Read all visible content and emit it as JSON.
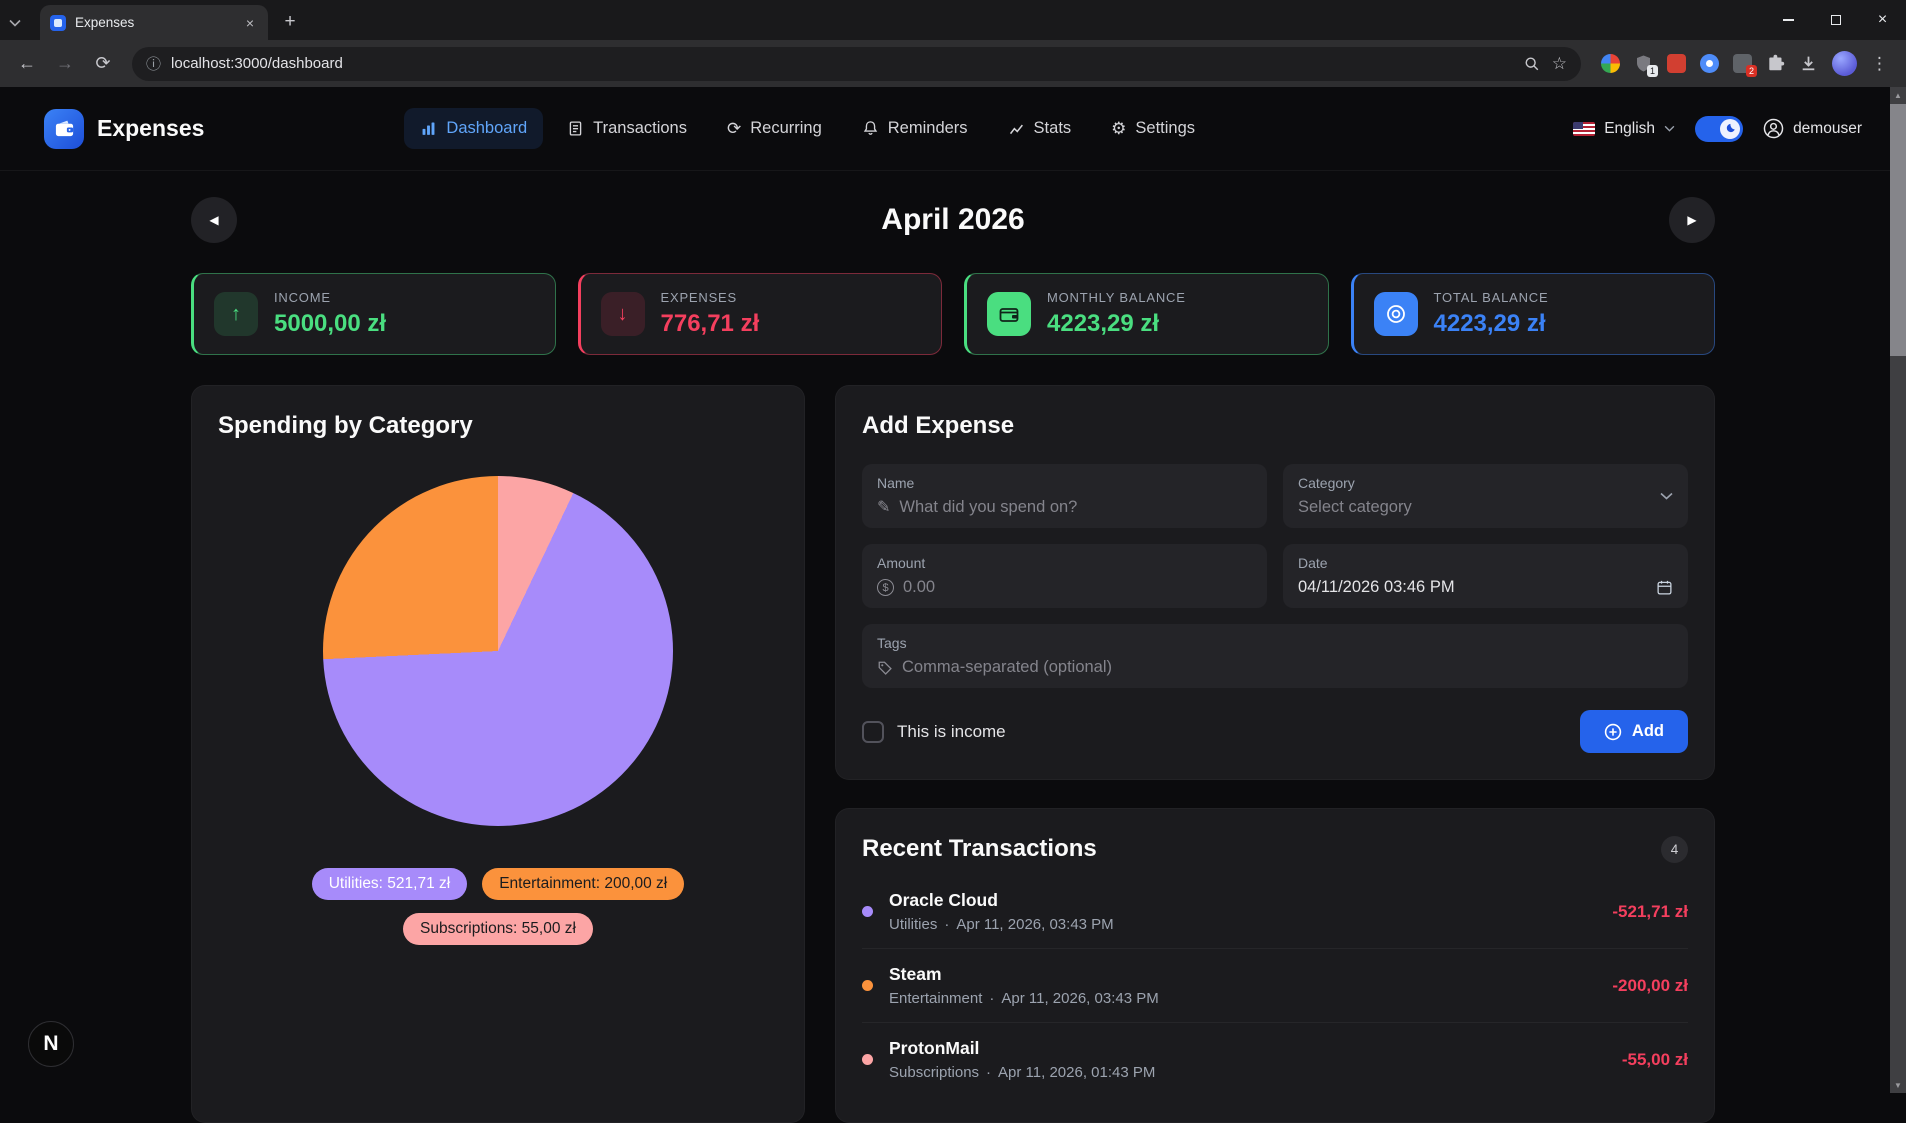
{
  "browser": {
    "tab_title": "Expenses",
    "url": "localhost:3000/dashboard",
    "extension_badges": [
      "1",
      "2"
    ]
  },
  "icons": {
    "back": "←",
    "forward": "→",
    "reload": "⟳",
    "info": "ⓘ",
    "star": "☆",
    "menu": "⋮",
    "close": "×",
    "new_tab": "+",
    "prev": "◀",
    "next": "▶",
    "scroll_up": "▲",
    "scroll_down": "▼",
    "pencil": "✎",
    "gear": "⚙",
    "recurring": "⟳",
    "currency": "$",
    "arrow_up": "↑",
    "arrow_down": "↓"
  },
  "header": {
    "app_title": "Expenses",
    "nav": [
      {
        "label": "Dashboard",
        "active": true
      },
      {
        "label": "Transactions",
        "active": false
      },
      {
        "label": "Recurring",
        "active": false
      },
      {
        "label": "Reminders",
        "active": false
      },
      {
        "label": "Stats",
        "active": false
      },
      {
        "label": "Settings",
        "active": false
      }
    ],
    "language": "English",
    "username": "demouser"
  },
  "month": {
    "title": "April 2026"
  },
  "stats": [
    {
      "label": "INCOME",
      "value": "5000,00 zł",
      "color": "#4ade80",
      "icon": "arrow-up",
      "tile_bg": "rgba(74,222,128,0.15)",
      "tile_fg": "#4ade80"
    },
    {
      "label": "EXPENSES",
      "value": "776,71 zł",
      "color": "#f43f5e",
      "icon": "arrow-down",
      "tile_bg": "rgba(244,63,94,0.15)",
      "tile_fg": "#f43f5e"
    },
    {
      "label": "MONTHLY BALANCE",
      "value": "4223,29 zł",
      "color": "#4ade80",
      "icon": "wallet",
      "tile_bg": "#4ade80",
      "tile_fg": "#10241a"
    },
    {
      "label": "TOTAL BALANCE",
      "value": "4223,29 zł",
      "color": "#3b82f6",
      "icon": "coin",
      "tile_bg": "#3b82f6",
      "tile_fg": "#ffffff"
    }
  ],
  "chart_data": {
    "type": "pie",
    "title": "Spending by Category",
    "total": 776.71,
    "currency": "zł",
    "legend_position": "bottom",
    "slices": [
      {
        "label": "Utilities",
        "value": 521.71,
        "display": "Utilities: 521,71 zł",
        "color": "#a78bfa",
        "text_color": "#ffffff"
      },
      {
        "label": "Entertainment",
        "value": 200.0,
        "display": "Entertainment: 200,00 zł",
        "color": "#fb923c",
        "text_color": "#1c1c1e"
      },
      {
        "label": "Subscriptions",
        "value": 55.0,
        "display": "Subscriptions: 55,00 zł",
        "color": "#fca5a5",
        "text_color": "#1c1c1e"
      }
    ],
    "slice_draw_order": [
      2,
      0,
      1
    ]
  },
  "add_expense": {
    "title": "Add Expense",
    "fields": {
      "name": {
        "label": "Name",
        "placeholder": "What did you spend on?"
      },
      "category": {
        "label": "Category",
        "value": "Select category"
      },
      "amount": {
        "label": "Amount",
        "placeholder": "0.00"
      },
      "date": {
        "label": "Date",
        "value": "04/11/2026 03:46 PM"
      },
      "tags": {
        "label": "Tags",
        "placeholder": "Comma-separated (optional)"
      }
    },
    "income_checkbox_label": "This is income",
    "add_button_label": "Add"
  },
  "transactions": {
    "title": "Recent Transactions",
    "count": "4",
    "meta_separator": "·",
    "items": [
      {
        "name": "Oracle Cloud",
        "category": "Utilities",
        "datetime": "Apr 11, 2026, 03:43 PM",
        "amount": "-521,71 zł",
        "color": "#a78bfa"
      },
      {
        "name": "Steam",
        "category": "Entertainment",
        "datetime": "Apr 11, 2026, 03:43 PM",
        "amount": "-200,00 zł",
        "color": "#fb923c"
      },
      {
        "name": "ProtonMail",
        "category": "Subscriptions",
        "datetime": "Apr 11, 2026, 01:43 PM",
        "amount": "-55,00 zł",
        "color": "#fca5a5"
      }
    ]
  },
  "dev_badge": "N"
}
